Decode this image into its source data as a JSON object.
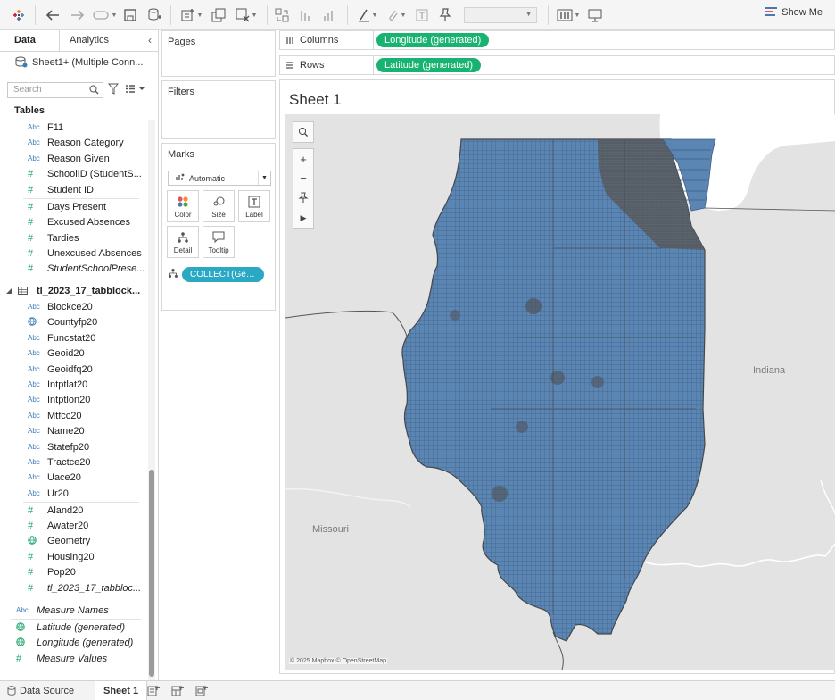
{
  "toolbar": {
    "show_me": "Show Me"
  },
  "data_pane": {
    "tabs": [
      "Data",
      "Analytics"
    ],
    "datasource": "Sheet1+ (Multiple Conn...",
    "search_placeholder": "Search",
    "tables_heading": "Tables",
    "fields": [
      {
        "label": "F11",
        "type": "abc"
      },
      {
        "label": "Reason Category",
        "type": "abc"
      },
      {
        "label": "Reason Given",
        "type": "abc"
      },
      {
        "label": "SchoolID (StudentS...",
        "type": "measure"
      },
      {
        "label": "Student ID",
        "type": "measure"
      },
      {
        "label": "Days Present",
        "type": "measure"
      },
      {
        "label": "Excused Absences",
        "type": "measure"
      },
      {
        "label": "Tardies",
        "type": "measure"
      },
      {
        "label": "Unexcused Absences",
        "type": "measure"
      },
      {
        "label": "StudentSchoolPrese...",
        "type": "measure"
      }
    ],
    "table2": {
      "name": "tl_2023_17_tabblock...",
      "fields": [
        {
          "label": "Blockce20",
          "type": "abc"
        },
        {
          "label": "Countyfp20",
          "type": "geo"
        },
        {
          "label": "Funcstat20",
          "type": "abc"
        },
        {
          "label": "Geoid20",
          "type": "abc"
        },
        {
          "label": "Geoidfq20",
          "type": "abc"
        },
        {
          "label": "Intptlat20",
          "type": "abc"
        },
        {
          "label": "Intptlon20",
          "type": "abc"
        },
        {
          "label": "Mtfcc20",
          "type": "abc"
        },
        {
          "label": "Name20",
          "type": "abc"
        },
        {
          "label": "Statefp20",
          "type": "abc"
        },
        {
          "label": "Tractce20",
          "type": "abc"
        },
        {
          "label": "Uace20",
          "type": "abc"
        },
        {
          "label": "Ur20",
          "type": "abc"
        },
        {
          "label": "Aland20",
          "type": "measure"
        },
        {
          "label": "Awater20",
          "type": "measure"
        },
        {
          "label": "Geometry",
          "type": "geo"
        },
        {
          "label": "Housing20",
          "type": "measure"
        },
        {
          "label": "Pop20",
          "type": "measure"
        },
        {
          "label": "tl_2023_17_tabbloc...",
          "type": "measure"
        }
      ]
    },
    "extra_fields": [
      {
        "label": "Measure Names",
        "type": "abc"
      },
      {
        "label": "Latitude (generated)",
        "type": "geo"
      },
      {
        "label": "Longitude (generated)",
        "type": "geo"
      },
      {
        "label": "Measure Values",
        "type": "measure"
      }
    ]
  },
  "cards": {
    "pages": "Pages",
    "filters": "Filters",
    "marks": "Marks",
    "mark_type": "Automatic",
    "buttons": [
      "Color",
      "Size",
      "Label",
      "Detail",
      "Tooltip"
    ],
    "marks_pill": "COLLECT(Geo..."
  },
  "shelves": {
    "columns_label": "Columns",
    "columns_pill": "Longitude (generated)",
    "rows_label": "Rows",
    "rows_pill": "Latitude (generated)"
  },
  "view": {
    "sheet_title": "Sheet 1",
    "map_labels": {
      "indiana": "Indiana",
      "missouri": "Missouri"
    },
    "attribution": "© 2025 Mapbox © OpenStreetMap"
  },
  "bottom_tabs": {
    "data_source": "Data Source",
    "sheet": "Sheet 1"
  },
  "colors": {
    "fill": "#5b86b4",
    "pill_green": "#19b371",
    "marks_pill": "#2aa8c4"
  }
}
